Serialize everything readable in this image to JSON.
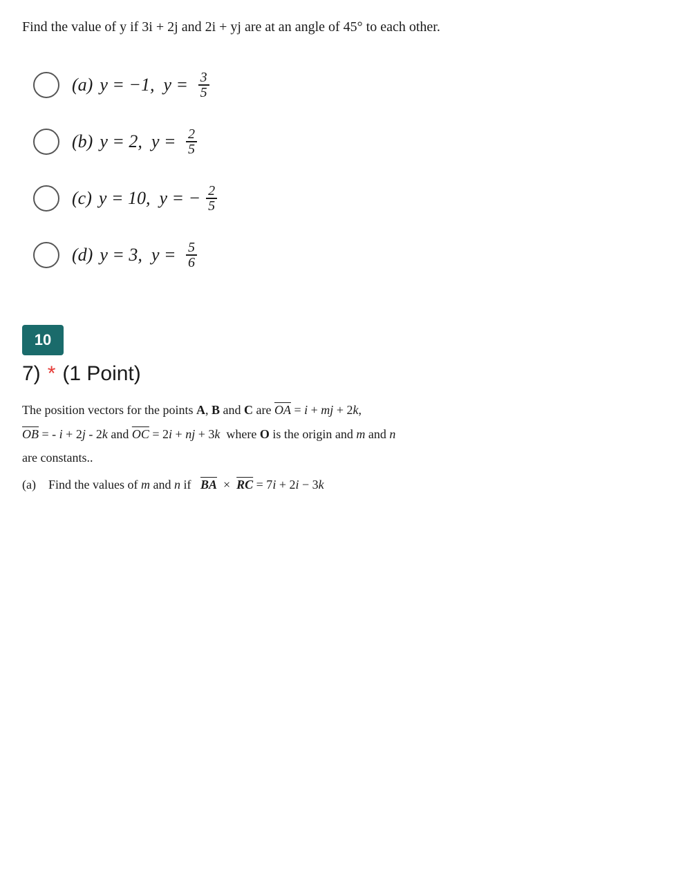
{
  "page": {
    "question_header": "Find the value of y if 3i + 2j and 2i + yj are at an angle of 45° to each other.",
    "options": [
      {
        "id": "a",
        "label": "(a)",
        "text": "y = −1, y = ",
        "fraction_num": "3",
        "fraction_den": "5"
      },
      {
        "id": "b",
        "label": "(b)",
        "text": "y = 2, y = ",
        "fraction_num": "2",
        "fraction_den": "5"
      },
      {
        "id": "c",
        "label": "(c)",
        "text": "y = 10, y = −",
        "fraction_num": "2",
        "fraction_den": "5"
      },
      {
        "id": "d",
        "label": "(d)",
        "text": "y = 3, y = ",
        "fraction_num": "5",
        "fraction_den": "6"
      }
    ],
    "section_number": "10",
    "question_subtitle": "7)",
    "asterisk": "*",
    "point_label": "(1 Point)",
    "question_body_line1": "The position vectors for the points A, B and C are OA = i + mj + 2k,",
    "question_body_line2": "OB = - i + 2j - 2k and OC = 2i + nj + 3k  where O is the origin and m and n",
    "question_body_line3": "are constants..",
    "sub_question": "(a)    Find the values of m and n if  BA × BC = 7i + 2i − 3k"
  }
}
